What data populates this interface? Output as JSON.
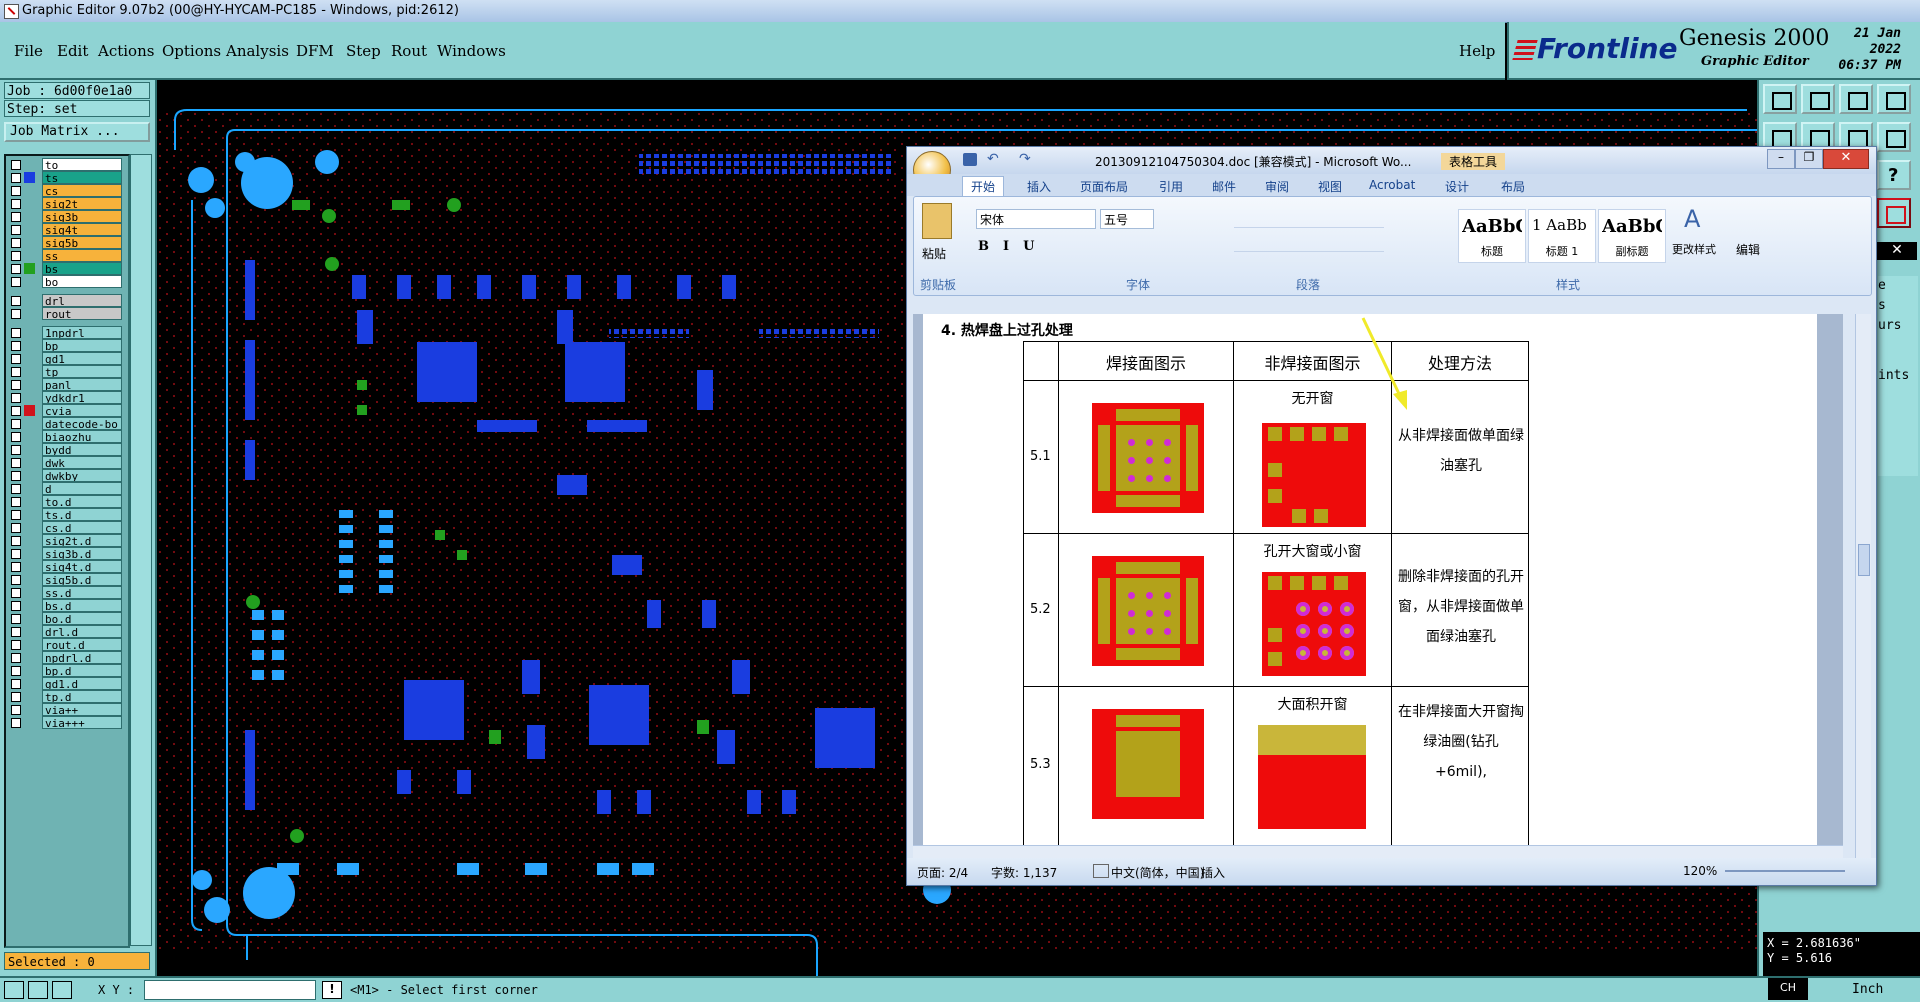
{
  "title_bar": {
    "text": "Graphic Editor 9.07b2 (00@HY-HYCAM-PC185 - Windows, pid:2612)"
  },
  "menu": {
    "items": [
      "File",
      "Edit",
      "Actions",
      "Options",
      "Analysis",
      "DFM",
      "Step",
      "Rout",
      "Windows"
    ],
    "help": "Help"
  },
  "brand": {
    "logo": "Frontline",
    "product": "Genesis 2000",
    "subtitle": "Graphic Editor",
    "date": "21 Jan 2022",
    "time": "06:37 PM"
  },
  "job_info": {
    "job": "Job : 6d00f0e1a0",
    "step": "Step: set",
    "job_matrix_button": "Job Matrix ..."
  },
  "layers": [
    {
      "name": "to",
      "color": "#ffffff"
    },
    {
      "name": "ts",
      "color": "#19a28a"
    },
    {
      "name": "cs",
      "color": "#f7b23b"
    },
    {
      "name": "sig2t",
      "color": "#f7b23b"
    },
    {
      "name": "sig3b",
      "color": "#f7b23b"
    },
    {
      "name": "sig4t",
      "color": "#f7b23b"
    },
    {
      "name": "sig5b",
      "color": "#f7b23b"
    },
    {
      "name": "ss",
      "color": "#f7b23b"
    },
    {
      "name": "bs",
      "color": "#19a28a"
    },
    {
      "name": "bo",
      "color": "#ffffff"
    },
    {
      "name": "drl",
      "color": "#c8c8c8"
    },
    {
      "name": "rout",
      "color": "#c8c8c8"
    },
    {
      "name": "1npdrl",
      "color": "#8fd3d3"
    },
    {
      "name": "bp",
      "color": "#8fd3d3"
    },
    {
      "name": "gd1",
      "color": "#8fd3d3"
    },
    {
      "name": "tp",
      "color": "#8fd3d3"
    },
    {
      "name": "panl",
      "color": "#8fd3d3"
    },
    {
      "name": "ydkdr1",
      "color": "#8fd3d3"
    },
    {
      "name": "cvia",
      "color": "#8fd3d3"
    },
    {
      "name": "datecode-bo",
      "color": "#8fd3d3"
    },
    {
      "name": "biaozhu",
      "color": "#8fd3d3"
    },
    {
      "name": "bydd",
      "color": "#8fd3d3"
    },
    {
      "name": "dwk",
      "color": "#8fd3d3"
    },
    {
      "name": "dwkby",
      "color": "#8fd3d3"
    },
    {
      "name": "d",
      "color": "#8fd3d3"
    },
    {
      "name": "to.d",
      "color": "#8fd3d3"
    },
    {
      "name": "ts.d",
      "color": "#8fd3d3"
    },
    {
      "name": "cs.d",
      "color": "#8fd3d3"
    },
    {
      "name": "sig2t.d",
      "color": "#8fd3d3"
    },
    {
      "name": "sig3b.d",
      "color": "#8fd3d3"
    },
    {
      "name": "sig4t.d",
      "color": "#8fd3d3"
    },
    {
      "name": "sig5b.d",
      "color": "#8fd3d3"
    },
    {
      "name": "ss.d",
      "color": "#8fd3d3"
    },
    {
      "name": "bs.d",
      "color": "#8fd3d3"
    },
    {
      "name": "bo.d",
      "color": "#8fd3d3"
    },
    {
      "name": "drl.d",
      "color": "#8fd3d3"
    },
    {
      "name": "rout.d",
      "color": "#8fd3d3"
    },
    {
      "name": "npdrl.d",
      "color": "#8fd3d3"
    },
    {
      "name": "bp.d",
      "color": "#8fd3d3"
    },
    {
      "name": "gd1.d",
      "color": "#8fd3d3"
    },
    {
      "name": "tp.d",
      "color": "#8fd3d3"
    },
    {
      "name": "via++",
      "color": "#8fd3d3"
    },
    {
      "name": "via+++",
      "color": "#8fd3d3"
    }
  ],
  "selected": "Selected : 0",
  "status": {
    "xy_label": "X Y :",
    "prompt": "<M1> - Select first corner",
    "units": "Inch",
    "lang": "CH"
  },
  "coords": {
    "x": "X = 2.681636\"",
    "y": "Y = 5.616"
  },
  "right_panel_fragments": [
    "e",
    "s",
    "urs",
    "ints"
  ],
  "word": {
    "title": "20130912104750304.doc [兼容模式] - Microsoft Wo...",
    "table_tools": "表格工具",
    "tabs": [
      "开始",
      "插入",
      "页面布局",
      "引用",
      "邮件",
      "审阅",
      "视图",
      "Acrobat",
      "设计",
      "布局"
    ],
    "font_name": "宋体",
    "font_size": "五号",
    "paste_label": "粘贴",
    "groups": {
      "clipboard": "剪贴板",
      "font": "字体",
      "paragraph": "段落",
      "styles": "样式",
      "editing": "编辑"
    },
    "styles": [
      {
        "sample": "AaBbC",
        "label": "标题"
      },
      {
        "sample": "1 AaBb",
        "label": "标题 1"
      },
      {
        "sample": "AaBbC",
        "label": "副标题"
      }
    ],
    "change_styles": "更改样式",
    "heading": "4. 热焊盘上过孔处理",
    "table": {
      "headers": [
        "焊接面图示",
        "非焊接面图示",
        "处理方法"
      ],
      "rows": [
        {
          "id": "5.1",
          "nonweld_label": "无开窗",
          "method": "从非焊接面做单面绿油塞孔"
        },
        {
          "id": "5.2",
          "nonweld_label": "孔开大窗或小窗",
          "method": "删除非焊接面的孔开窗，从非焊接面做单面绿油塞孔"
        },
        {
          "id": "5.3",
          "nonweld_label": "大面积开窗",
          "method": "在非焊接面大开窗掏绿油圈(钻孔+6mil),"
        }
      ]
    },
    "status": {
      "page": "页面: 2/4",
      "words": "字数: 1,137",
      "lang": "中文(简体，中国)",
      "mode": "插入",
      "zoom": "120%"
    }
  }
}
